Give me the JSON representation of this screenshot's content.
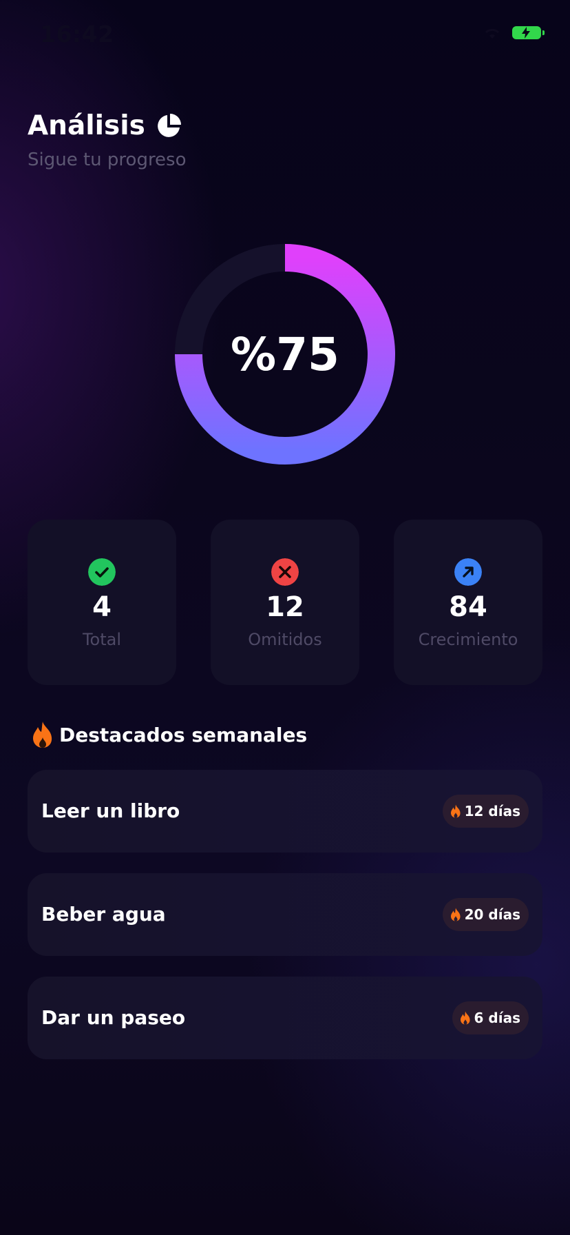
{
  "status_bar": {
    "time": "16:42"
  },
  "header": {
    "title": "Análisis",
    "subtitle": "Sigue tu progreso",
    "icon": "pie-chart-icon"
  },
  "progress": {
    "label": "%75",
    "value": 75,
    "gradient_start": "#e040fb",
    "gradient_end": "#6e73ff",
    "track_color": "#15112b"
  },
  "stats": [
    {
      "icon": "check-icon",
      "value": "4",
      "label": "Total",
      "color": "#22c55e"
    },
    {
      "icon": "x-icon",
      "value": "12",
      "label": "Omitidos",
      "color": "#ef4444"
    },
    {
      "icon": "arrow-up-right-icon",
      "value": "84",
      "label": "Crecimiento",
      "color": "#3b82f6"
    }
  ],
  "highlights": {
    "title": "Destacados semanales",
    "icon": "fire-icon",
    "items": [
      {
        "name": "Leer un libro",
        "streak": "12 días"
      },
      {
        "name": "Beber agua",
        "streak": "20 días"
      },
      {
        "name": "Dar un paseo",
        "streak": "6 días"
      }
    ]
  }
}
